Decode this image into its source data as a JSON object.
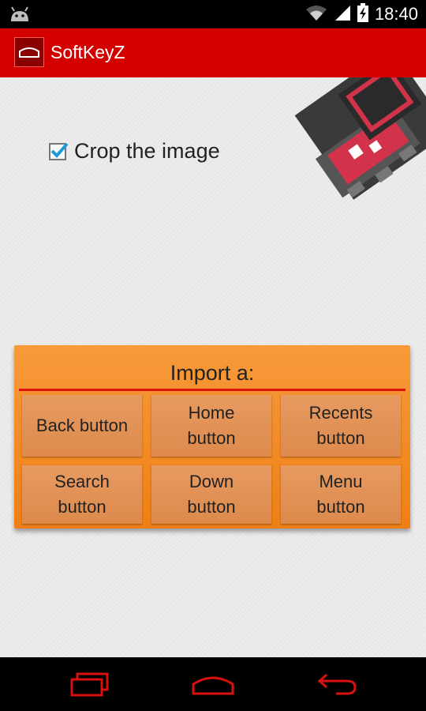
{
  "status_bar": {
    "time": "18:40",
    "icons": [
      "android-debug-icon",
      "wifi-icon",
      "signal-icon",
      "battery-charging-icon"
    ]
  },
  "action_bar": {
    "title": "SoftKeyZ",
    "icon": "home-key-icon"
  },
  "settings": {
    "crop_label": "Crop the image",
    "crop_checked": true
  },
  "import_panel": {
    "title": "Import a:",
    "buttons": [
      {
        "line1": "Back button",
        "line2": ""
      },
      {
        "line1": "Home",
        "line2": "button"
      },
      {
        "line1": "Recents",
        "line2": "button"
      },
      {
        "line1": "Search",
        "line2": "button"
      },
      {
        "line1": "Down",
        "line2": "button"
      },
      {
        "line1": "Menu",
        "line2": "button"
      }
    ]
  },
  "nav_bar": {
    "icons": [
      "recents-nav-icon",
      "home-nav-icon",
      "back-nav-icon"
    ]
  },
  "colors": {
    "action_bar": "#d40000",
    "panel": "#f0841c",
    "tile": "#e0904f",
    "nav_icons": "#d81010"
  }
}
